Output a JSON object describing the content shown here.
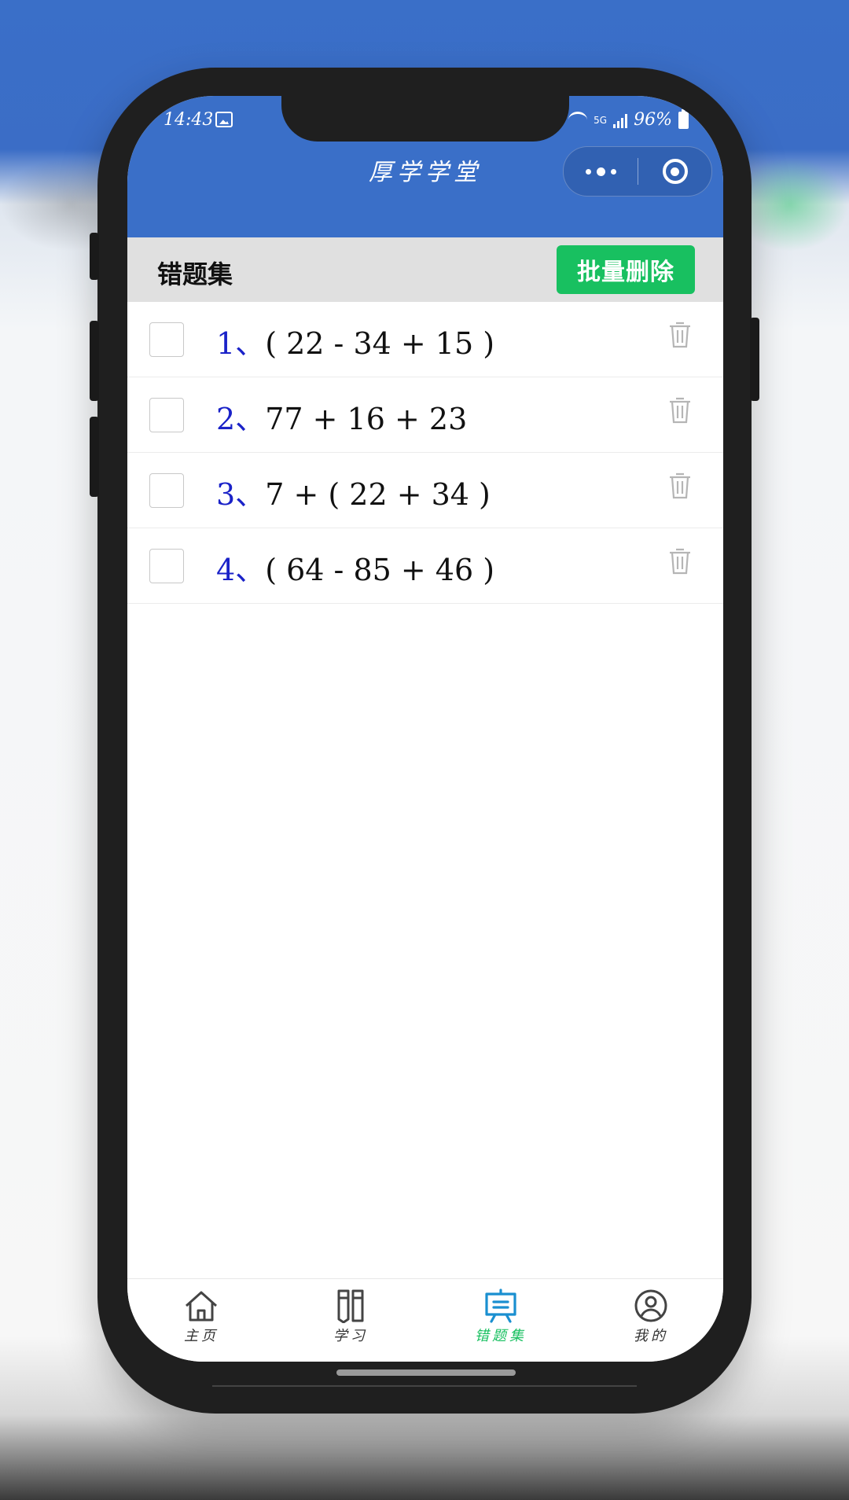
{
  "status_bar": {
    "time": "14:43",
    "network": "5G",
    "battery": "96%"
  },
  "header": {
    "title": "厚学学堂",
    "more_icon": "more-dots-icon",
    "close_icon": "target-circle-icon"
  },
  "toolbar": {
    "title": "错题集",
    "batch_delete_label": "批量删除"
  },
  "questions": [
    {
      "number": "1、",
      "expression": "( 22 - 34 + 15 )"
    },
    {
      "number": "2、",
      "expression": "77 + 16 + 23"
    },
    {
      "number": "3、",
      "expression": "7 + ( 22 + 34 )"
    },
    {
      "number": "4、",
      "expression": "( 64 - 85 + 46 )"
    }
  ],
  "tabbar": {
    "tabs": [
      {
        "label": "主页",
        "icon": "home-icon"
      },
      {
        "label": "学习",
        "icon": "book-icon"
      },
      {
        "label": "错题集",
        "icon": "board-icon",
        "active": true
      },
      {
        "label": "我的",
        "icon": "user-icon"
      }
    ]
  },
  "colors": {
    "header_bg": "#3a6fc8",
    "accent_green": "#18c060",
    "question_number": "#1a22c8",
    "active_tab_icon": "#1a8fd0"
  }
}
